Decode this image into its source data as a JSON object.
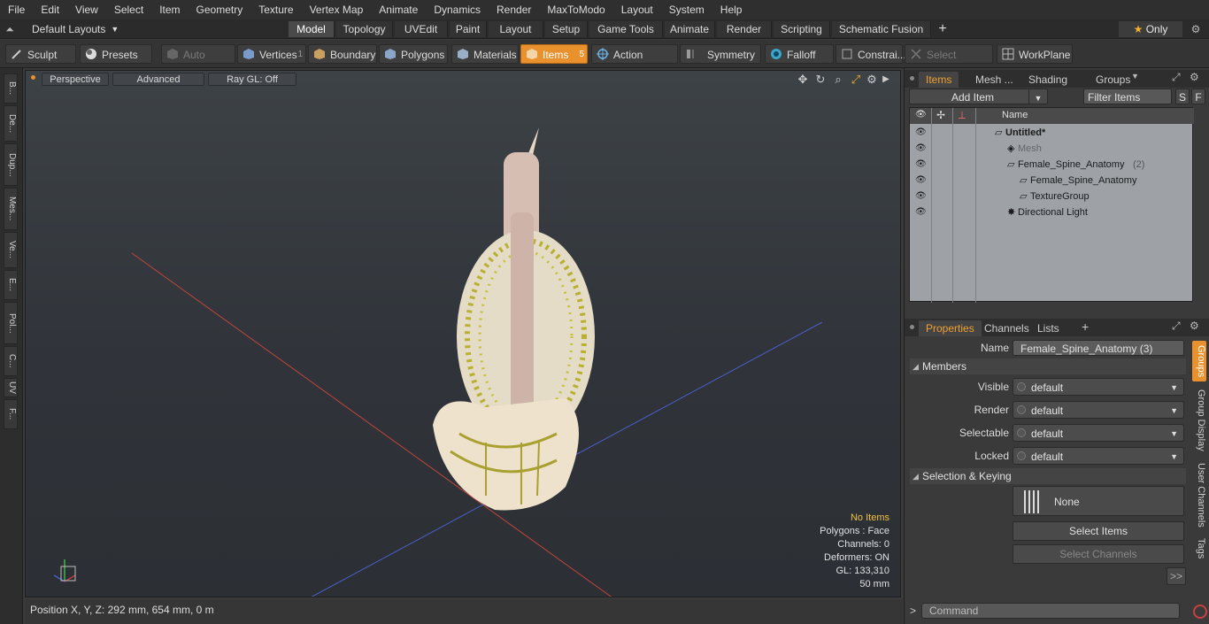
{
  "menu": [
    "File",
    "Edit",
    "View",
    "Select",
    "Item",
    "Geometry",
    "Texture",
    "Vertex Map",
    "Animate",
    "Dynamics",
    "Render",
    "MaxToModo",
    "Layout",
    "System",
    "Help"
  ],
  "layouts_label": "Default Layouts",
  "layout_tabs": [
    "Model",
    "Topology",
    "UVEdit",
    "Paint",
    "Layout",
    "Setup",
    "Game Tools",
    "Animate",
    "Render",
    "Scripting",
    "Schematic Fusion"
  ],
  "layout_tab_active": "Model",
  "only_label": "Only",
  "toolbar": {
    "sculpt": "Sculpt",
    "presets": "Presets",
    "auto_select": "Auto Select",
    "vertices": "Vertices",
    "vertices_count": "1",
    "boundary": "Boundary",
    "polygons": "Polygons",
    "materials": "Materials",
    "items": "Items",
    "items_count": "5",
    "action_center": "Action Center",
    "symmetry": "Symmetry",
    "falloff": "Falloff",
    "constraints": "Constrai...",
    "select_through": "Select Through",
    "workplane": "WorkPlane"
  },
  "left_strip": [
    "B...",
    "De...",
    "Dup...",
    "Mes...",
    "Ve...",
    "E...",
    "Pol...",
    "C...",
    "UV",
    "F..."
  ],
  "viewport": {
    "view_mode": "Perspective",
    "advanced": "Advanced",
    "ray_gl": "Ray GL: Off",
    "hud": {
      "no_items": "No Items",
      "polygons": "Polygons : Face",
      "channels": "Channels: 0",
      "deformers": "Deformers: ON",
      "gl": "GL: 133,310",
      "scale": "50 mm"
    }
  },
  "status_bar": {
    "position": "Position X, Y, Z:   292 mm, 654 mm, 0 m"
  },
  "items_panel": {
    "tabs": [
      "Items",
      "Mesh ...",
      "Shading",
      "Groups"
    ],
    "active_tab": "Items",
    "add_item": "Add Item",
    "filter_items": "Filter Items",
    "s_btn": "S",
    "f_btn": "F",
    "name_header": "Name",
    "tree": [
      {
        "label": "Untitled*",
        "indent": 0,
        "bold": true
      },
      {
        "label": "Mesh",
        "indent": 1,
        "dim": true
      },
      {
        "label": "Female_Spine_Anatomy",
        "suffix": "(2)",
        "indent": 1
      },
      {
        "label": "Female_Spine_Anatomy",
        "indent": 2
      },
      {
        "label": "TextureGroup",
        "indent": 2
      },
      {
        "label": "Directional Light",
        "indent": 1
      }
    ]
  },
  "properties_panel": {
    "tabs": [
      "Properties",
      "Channels",
      "Lists"
    ],
    "active_tab": "Properties",
    "name_label": "Name",
    "name_value": "Female_Spine_Anatomy (3)",
    "members_section": "Members",
    "fields": [
      {
        "label": "Visible",
        "value": "default"
      },
      {
        "label": "Render",
        "value": "default"
      },
      {
        "label": "Selectable",
        "value": "default"
      },
      {
        "label": "Locked",
        "value": "default"
      }
    ],
    "selection_section": "Selection & Keying",
    "none_label": "None",
    "select_items": "Select Items",
    "select_channels": "Select Channels",
    "more": ">>",
    "side_tabs": [
      "Groups",
      "Group Display",
      "User Channels",
      "Tags"
    ]
  },
  "command": {
    "placeholder": "Command"
  },
  "colors": {
    "accent": "#e8912d",
    "hud_highlight": "#f0c040"
  }
}
